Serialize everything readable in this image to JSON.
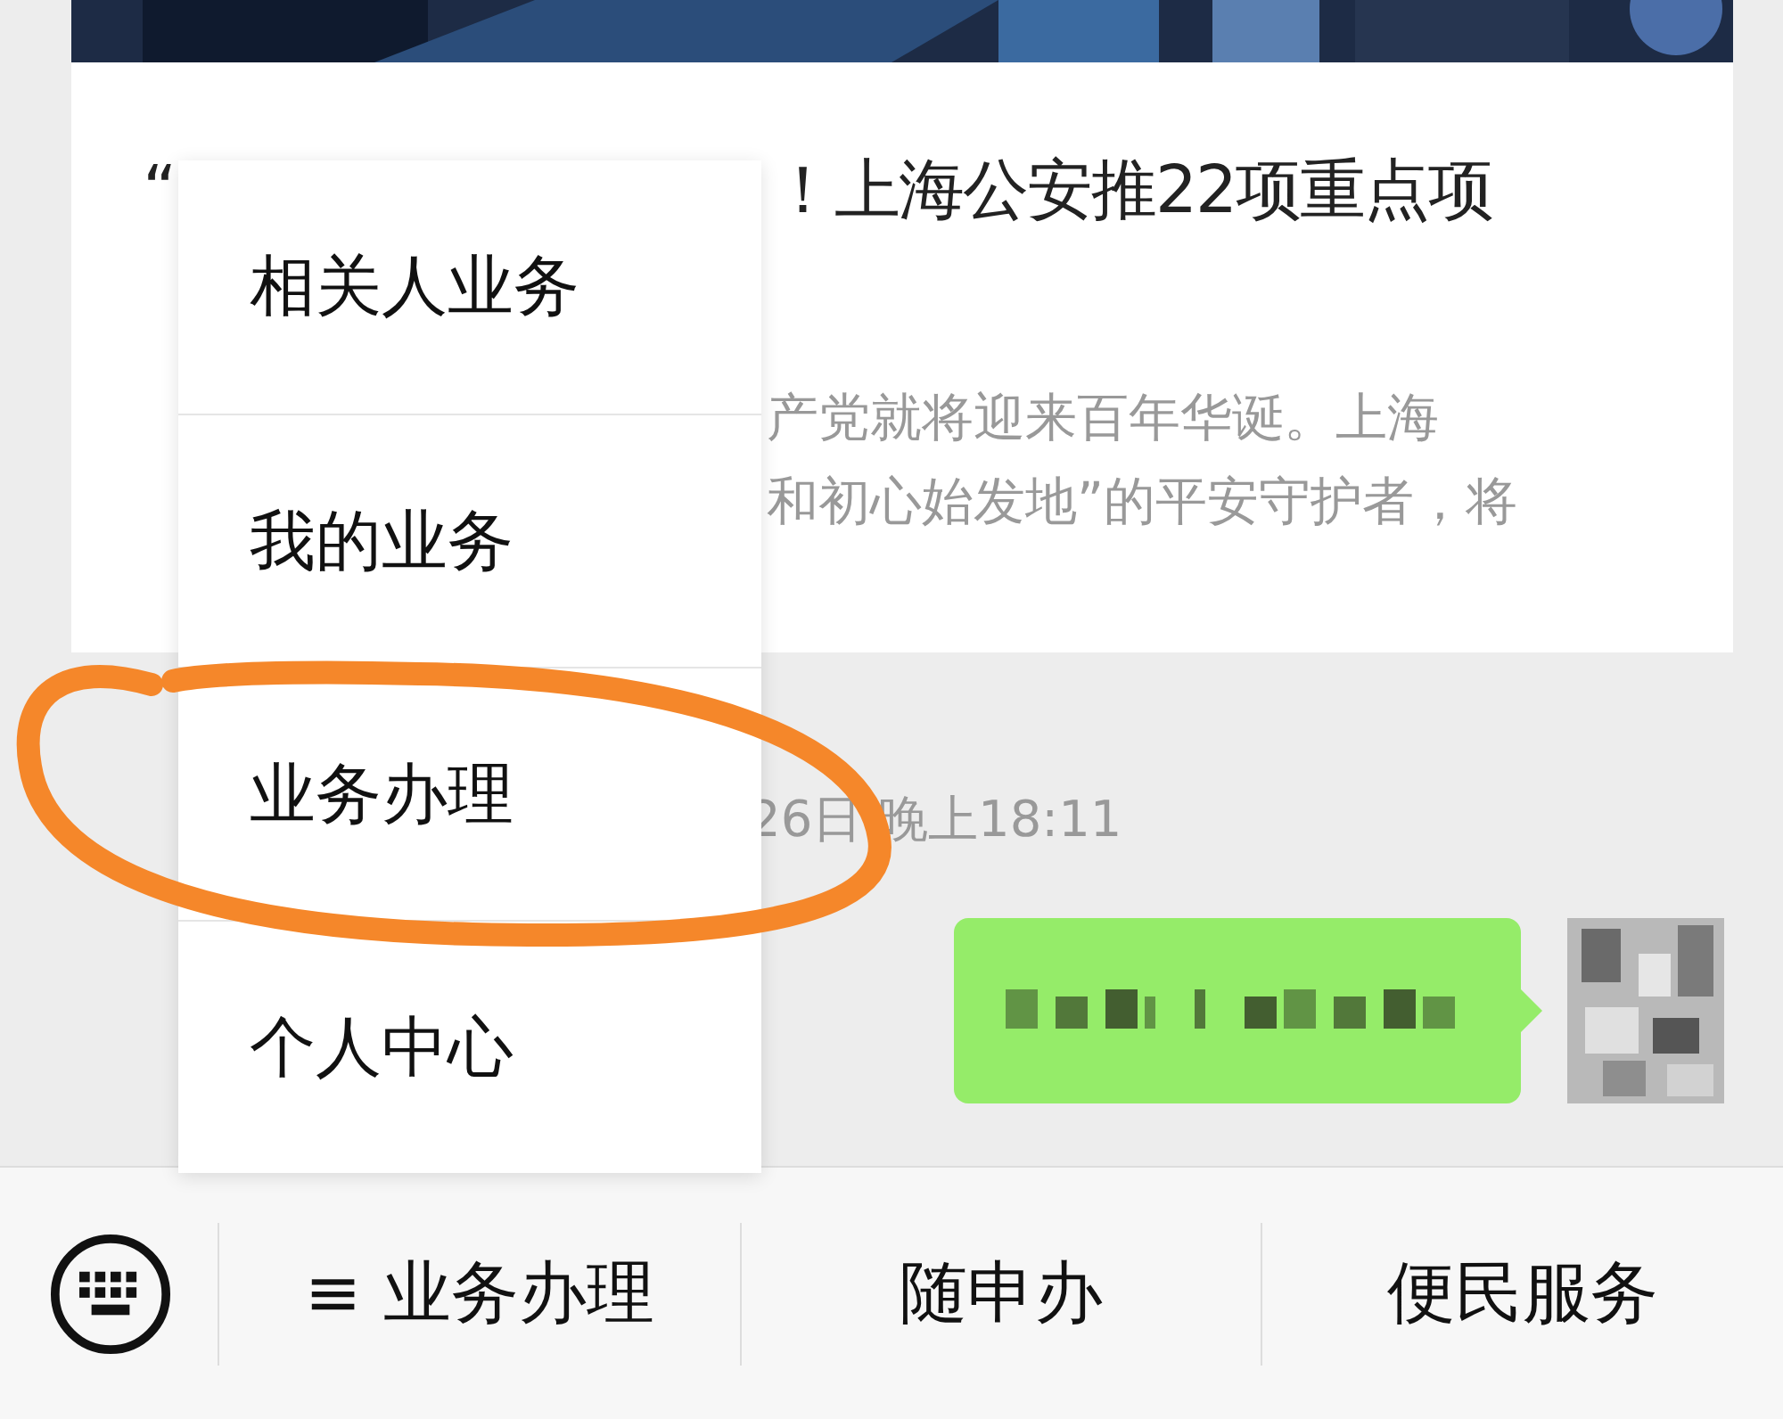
{
  "article": {
    "title_left": "“",
    "title_right": "！上海公安推22项重点项",
    "summary_lines": [
      "产党就将迎来百年华诞。上海",
      "和初心始发地”的平安守护者，将"
    ]
  },
  "timestamp": "26日 晚上18:11",
  "popup_menu": {
    "items": [
      "相关人业务",
      "我的业务",
      "业务办理",
      "个人中心"
    ]
  },
  "bottom_menu": {
    "tabs": [
      "≡ 业务办理",
      "随申办",
      "便民服务"
    ]
  }
}
